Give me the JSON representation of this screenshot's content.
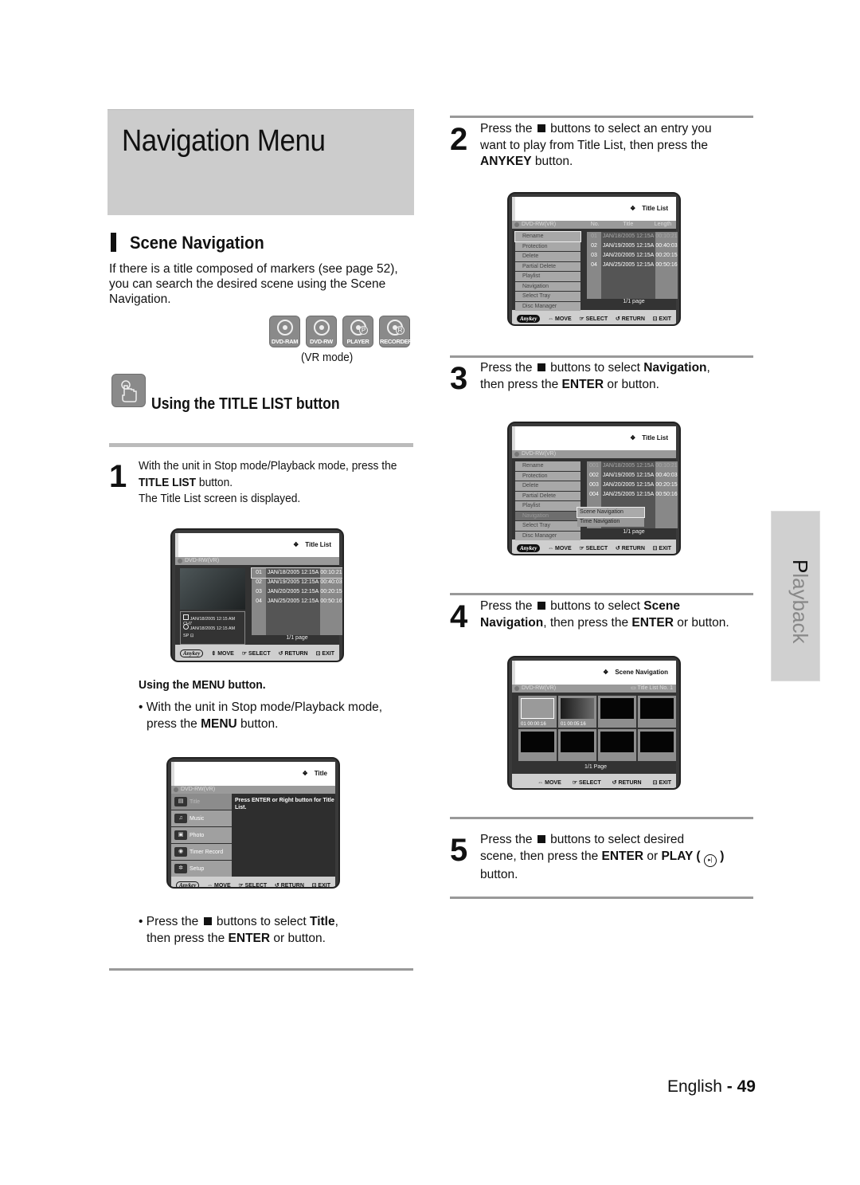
{
  "header": {
    "title": "Navigation Menu"
  },
  "section": {
    "title": "Scene Navigation",
    "intro": "If there is a title composed of markers (see page 52), you can search the desired scene using the Scene Navigation."
  },
  "discs": [
    {
      "label": "DVD-RAM",
      "icon": "disc-icon"
    },
    {
      "label": "DVD-RW",
      "icon": "disc-icon"
    },
    {
      "label": "PLAYER",
      "letter": "P",
      "icon": "player-icon"
    },
    {
      "label": "RECORDER",
      "letter": "R",
      "icon": "recorder-icon"
    }
  ],
  "vr_mode": "(VR mode)",
  "title_list_section": {
    "title": "Using the TITLE LIST button"
  },
  "step1": {
    "number": "1",
    "line1": "With the unit in Stop mode/Playback mode, press the",
    "bold": "TITLE LIST",
    "line2_rest": " button.",
    "line3": "The Title List screen is displayed."
  },
  "osd_common": {
    "disc_type": "DVD-RW(VR)",
    "move": "MOVE",
    "select": "SELECT",
    "return": "RETURN",
    "exit": "EXIT",
    "anykey": "Anykey"
  },
  "osd1": {
    "title": "Title List",
    "rows": [
      {
        "no": "01",
        "title": "JAN/18/2005 12:15A",
        "length": "00:10:21"
      },
      {
        "no": "02",
        "title": "JAN/19/2005 12:15A",
        "length": "00:40:03"
      },
      {
        "no": "03",
        "title": "JAN/20/2005 12:15A",
        "length": "00:20:15"
      },
      {
        "no": "04",
        "title": "JAN/25/2005 12:15A",
        "length": "00:50:16"
      }
    ],
    "info_line1": "JAN/18/2005 12:15 AM CH7",
    "info_line2": "JAN/18/2005 12:15 AM",
    "info_line3": "SP",
    "pager": "1/1 page"
  },
  "menu_section": {
    "title": "Using the MENU button.",
    "bullet1_a": "With the unit in Stop mode/Playback mode,",
    "bullet1_b": "press the ",
    "bullet1_bold": "MENU",
    "bullet1_c": " button."
  },
  "osd_menu": {
    "title": "Title",
    "items": [
      "Title",
      "Music",
      "Photo",
      "Timer Record",
      "Setup"
    ],
    "message": "Press ENTER or Right button for Title List."
  },
  "menu_bullet2": {
    "a": "Press the ",
    "b": " buttons to select ",
    "bold1": "Title",
    "c": ",",
    "d": "then press the ",
    "bold2": "ENTER",
    "e": " or    button."
  },
  "step2": {
    "number": "2",
    "a": "Press the ",
    "b": "    buttons to select an entry you",
    "line2": "want to play from Title List, then press the",
    "bold": "ANYKEY",
    "line3_rest": " button."
  },
  "osd2": {
    "title": "Title List",
    "col_no": "No.",
    "col_title": "Title",
    "col_length": "Length",
    "menu": [
      "Rename",
      "Protection",
      "Delete",
      "Partial Delete",
      "Playlist",
      "Navigation",
      "Select Tray",
      "Disc Manager"
    ],
    "pager": "1/1 page"
  },
  "step3": {
    "number": "3",
    "a": "Press the ",
    "b": "    buttons to select ",
    "bold1": "Navigation",
    "c": ",",
    "d": "then press the ",
    "bold2": "ENTER",
    "e": " or     button."
  },
  "osd3": {
    "title": "Title List",
    "rows": [
      {
        "no": "001",
        "title": "JAN/18/2005 12:15A",
        "length": "00:10:21"
      },
      {
        "no": "002",
        "title": "JAN/19/2005 12:15A",
        "length": "00:40:03"
      },
      {
        "no": "003",
        "title": "JAN/20/2005 12:15A",
        "length": "00:20:15"
      },
      {
        "no": "004",
        "title": "JAN/25/2005 12:15A",
        "length": "00:50:16"
      }
    ],
    "submenu": [
      "Scene Navigation",
      "Time Navigation"
    ],
    "pager": "1/1 page"
  },
  "step4": {
    "number": "4",
    "a": "Press the ",
    "b": "    buttons to select ",
    "bold1": "Scene",
    "bold2": "Navigation",
    "c": ", then press the ",
    "bold3": "ENTER",
    "d": " or     button."
  },
  "osd4": {
    "title": "Scene Navigation",
    "title_list_no": "Title List No. 1",
    "scenes": [
      {
        "no": "01",
        "time": "00:00:16"
      },
      {
        "no": "01",
        "time": "00:05:16"
      }
    ],
    "pager": "1/1 Page"
  },
  "step5": {
    "number": "5",
    "a": "Press the ",
    "b": "          buttons to select desired",
    "c": "scene, then press the ",
    "bold1": "ENTER",
    "d": " or ",
    "bold2": "PLAY (",
    "bold3": ")",
    "line3": "button."
  },
  "side_tab": "Playback",
  "footer": {
    "language": "English",
    "sep": " - ",
    "page": "49"
  }
}
